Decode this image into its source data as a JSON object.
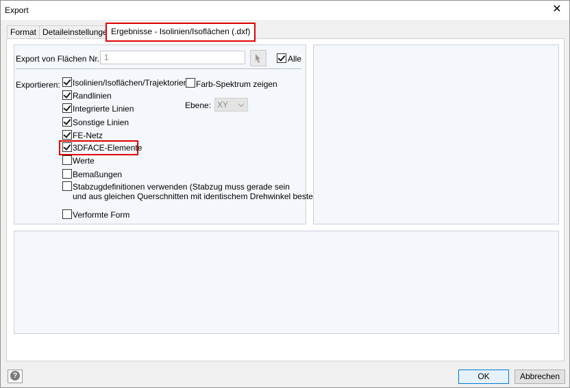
{
  "window": {
    "title": "Export",
    "close_icon": "close-icon"
  },
  "tabs": [
    {
      "label": "Format"
    },
    {
      "label": "Detaileinstellungen"
    },
    {
      "label": "Ergebnisse - Isolinien/Isoflächen (.dxf)",
      "active": true
    }
  ],
  "export_from": {
    "label": "Export von Flächen Nr.:",
    "value": "1",
    "pick_icon": "pick-surface-icon",
    "all_label": "Alle",
    "all_checked": true
  },
  "export": {
    "label": "Exportieren:",
    "options": [
      {
        "label": "Isolinien/Isoflächen/Trajektorien",
        "checked": true
      },
      {
        "label": "Randlinien",
        "checked": true
      },
      {
        "label": "Integrierte Linien",
        "checked": true
      },
      {
        "label": "Sonstige Linien",
        "checked": true
      },
      {
        "label": "FE-Netz",
        "checked": true
      },
      {
        "label": "3DFACE-Elemente",
        "checked": true
      },
      {
        "label": "Werte",
        "checked": false
      },
      {
        "label": "Bemaßungen",
        "checked": false
      },
      {
        "label_line1": "Stabzugdefinitionen verwenden (Stabzug muss gerade sein",
        "label_line2": "und aus gleichen Querschnitten mit identischem Drehwinkel bestehen)",
        "checked": false
      },
      {
        "label": "Verformte Form",
        "checked": false
      }
    ],
    "spectrum": {
      "label": "Farb-Spektrum zeigen",
      "checked": false
    },
    "plane": {
      "label": "Ebene:",
      "value": "XY"
    }
  },
  "footer": {
    "help_icon": "help-icon",
    "ok_label": "OK",
    "cancel_label": "Abbrechen"
  },
  "colors": {
    "highlight": "#e00000",
    "group_bg": "#f4f7fb",
    "accent": "#0078d7"
  }
}
